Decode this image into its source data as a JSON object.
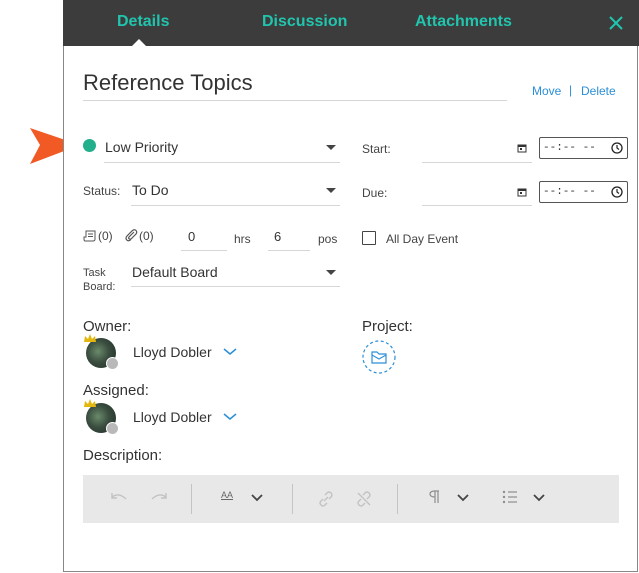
{
  "tabs": {
    "details": "Details",
    "discussion": "Discussion",
    "attachments": "Attachments"
  },
  "title": "Reference Topics",
  "actions": {
    "move": "Move",
    "separator": "|",
    "delete": "Delete"
  },
  "priority": {
    "label": "Low Priority",
    "color": "#21b08b"
  },
  "status": {
    "label": "Status:",
    "value": "To Do"
  },
  "start": {
    "label": "Start:",
    "time": "--:-- --"
  },
  "due": {
    "label": "Due:",
    "time": "--:-- --"
  },
  "counts": {
    "notes": "(0)",
    "attachments": "(0)"
  },
  "hours": {
    "value": "0",
    "unit": "hrs"
  },
  "position": {
    "value": "6",
    "unit": "pos"
  },
  "all_day": {
    "label": "All Day Event",
    "checked": false
  },
  "task_board": {
    "label_line1": "Task",
    "label_line2": "Board:",
    "value": "Default Board"
  },
  "owner": {
    "label": "Owner:",
    "name": "Lloyd Dobler"
  },
  "project": {
    "label": "Project:"
  },
  "assigned": {
    "label": "Assigned:",
    "name": "Lloyd Dobler"
  },
  "description": {
    "label": "Description:"
  },
  "toolbar": {
    "font_size_label": "AA"
  },
  "colors": {
    "accent": "#21c5ae",
    "link": "#2b8fd6",
    "header_bg": "#3c3c3c",
    "pointer": "#f15a24"
  }
}
